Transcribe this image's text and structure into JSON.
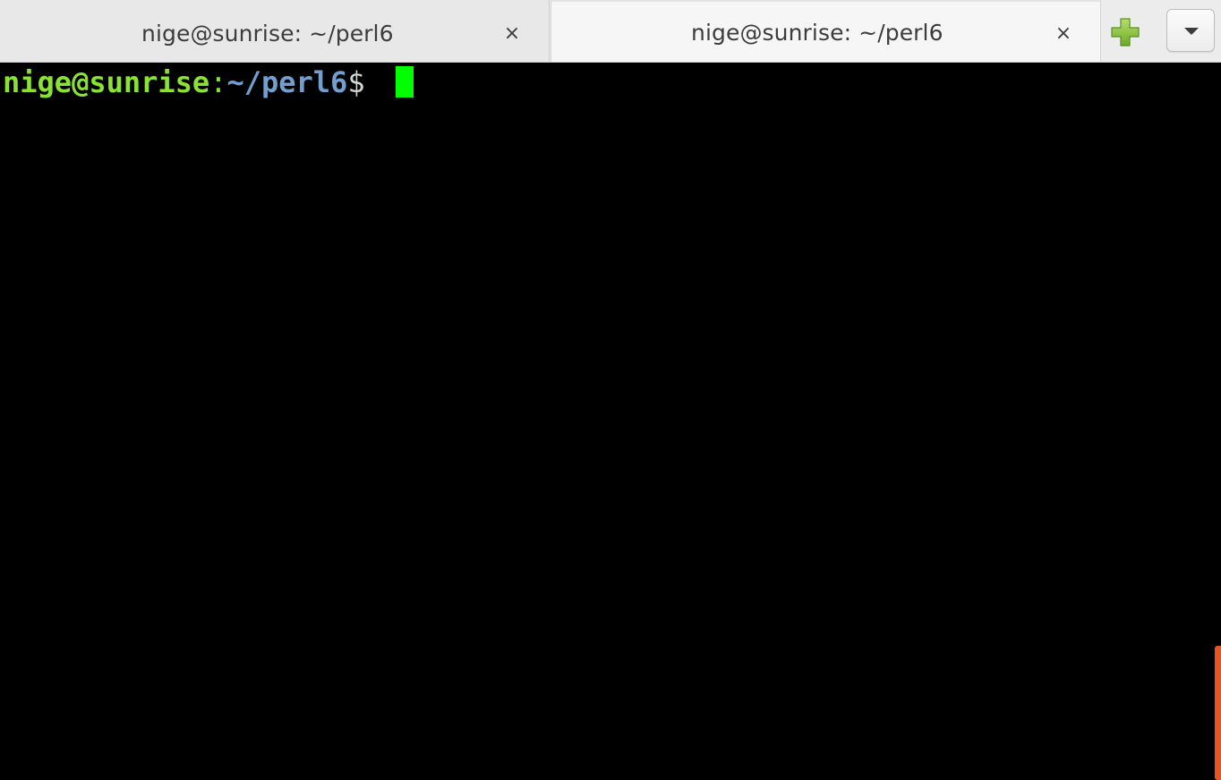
{
  "tabs": [
    {
      "label": "nige@sunrise: ~/perl6",
      "close_label": "×",
      "active": false
    },
    {
      "label": "nige@sunrise: ~/perl6",
      "close_label": "×",
      "active": true
    }
  ],
  "terminal": {
    "prompt": {
      "user_host": "nige@sunrise",
      "separator": ":",
      "path": "~/perl6",
      "symbol": "$"
    }
  },
  "icons": {
    "new_tab": "plus-icon",
    "tab_menu": "chevron-down-icon"
  },
  "colors": {
    "prompt_user": "#8ae234",
    "prompt_path": "#729fcf",
    "cursor": "#00ff00",
    "scrollbar": "#e95420",
    "terminal_bg": "#000000",
    "new_tab_icon": "#8ac43c"
  }
}
